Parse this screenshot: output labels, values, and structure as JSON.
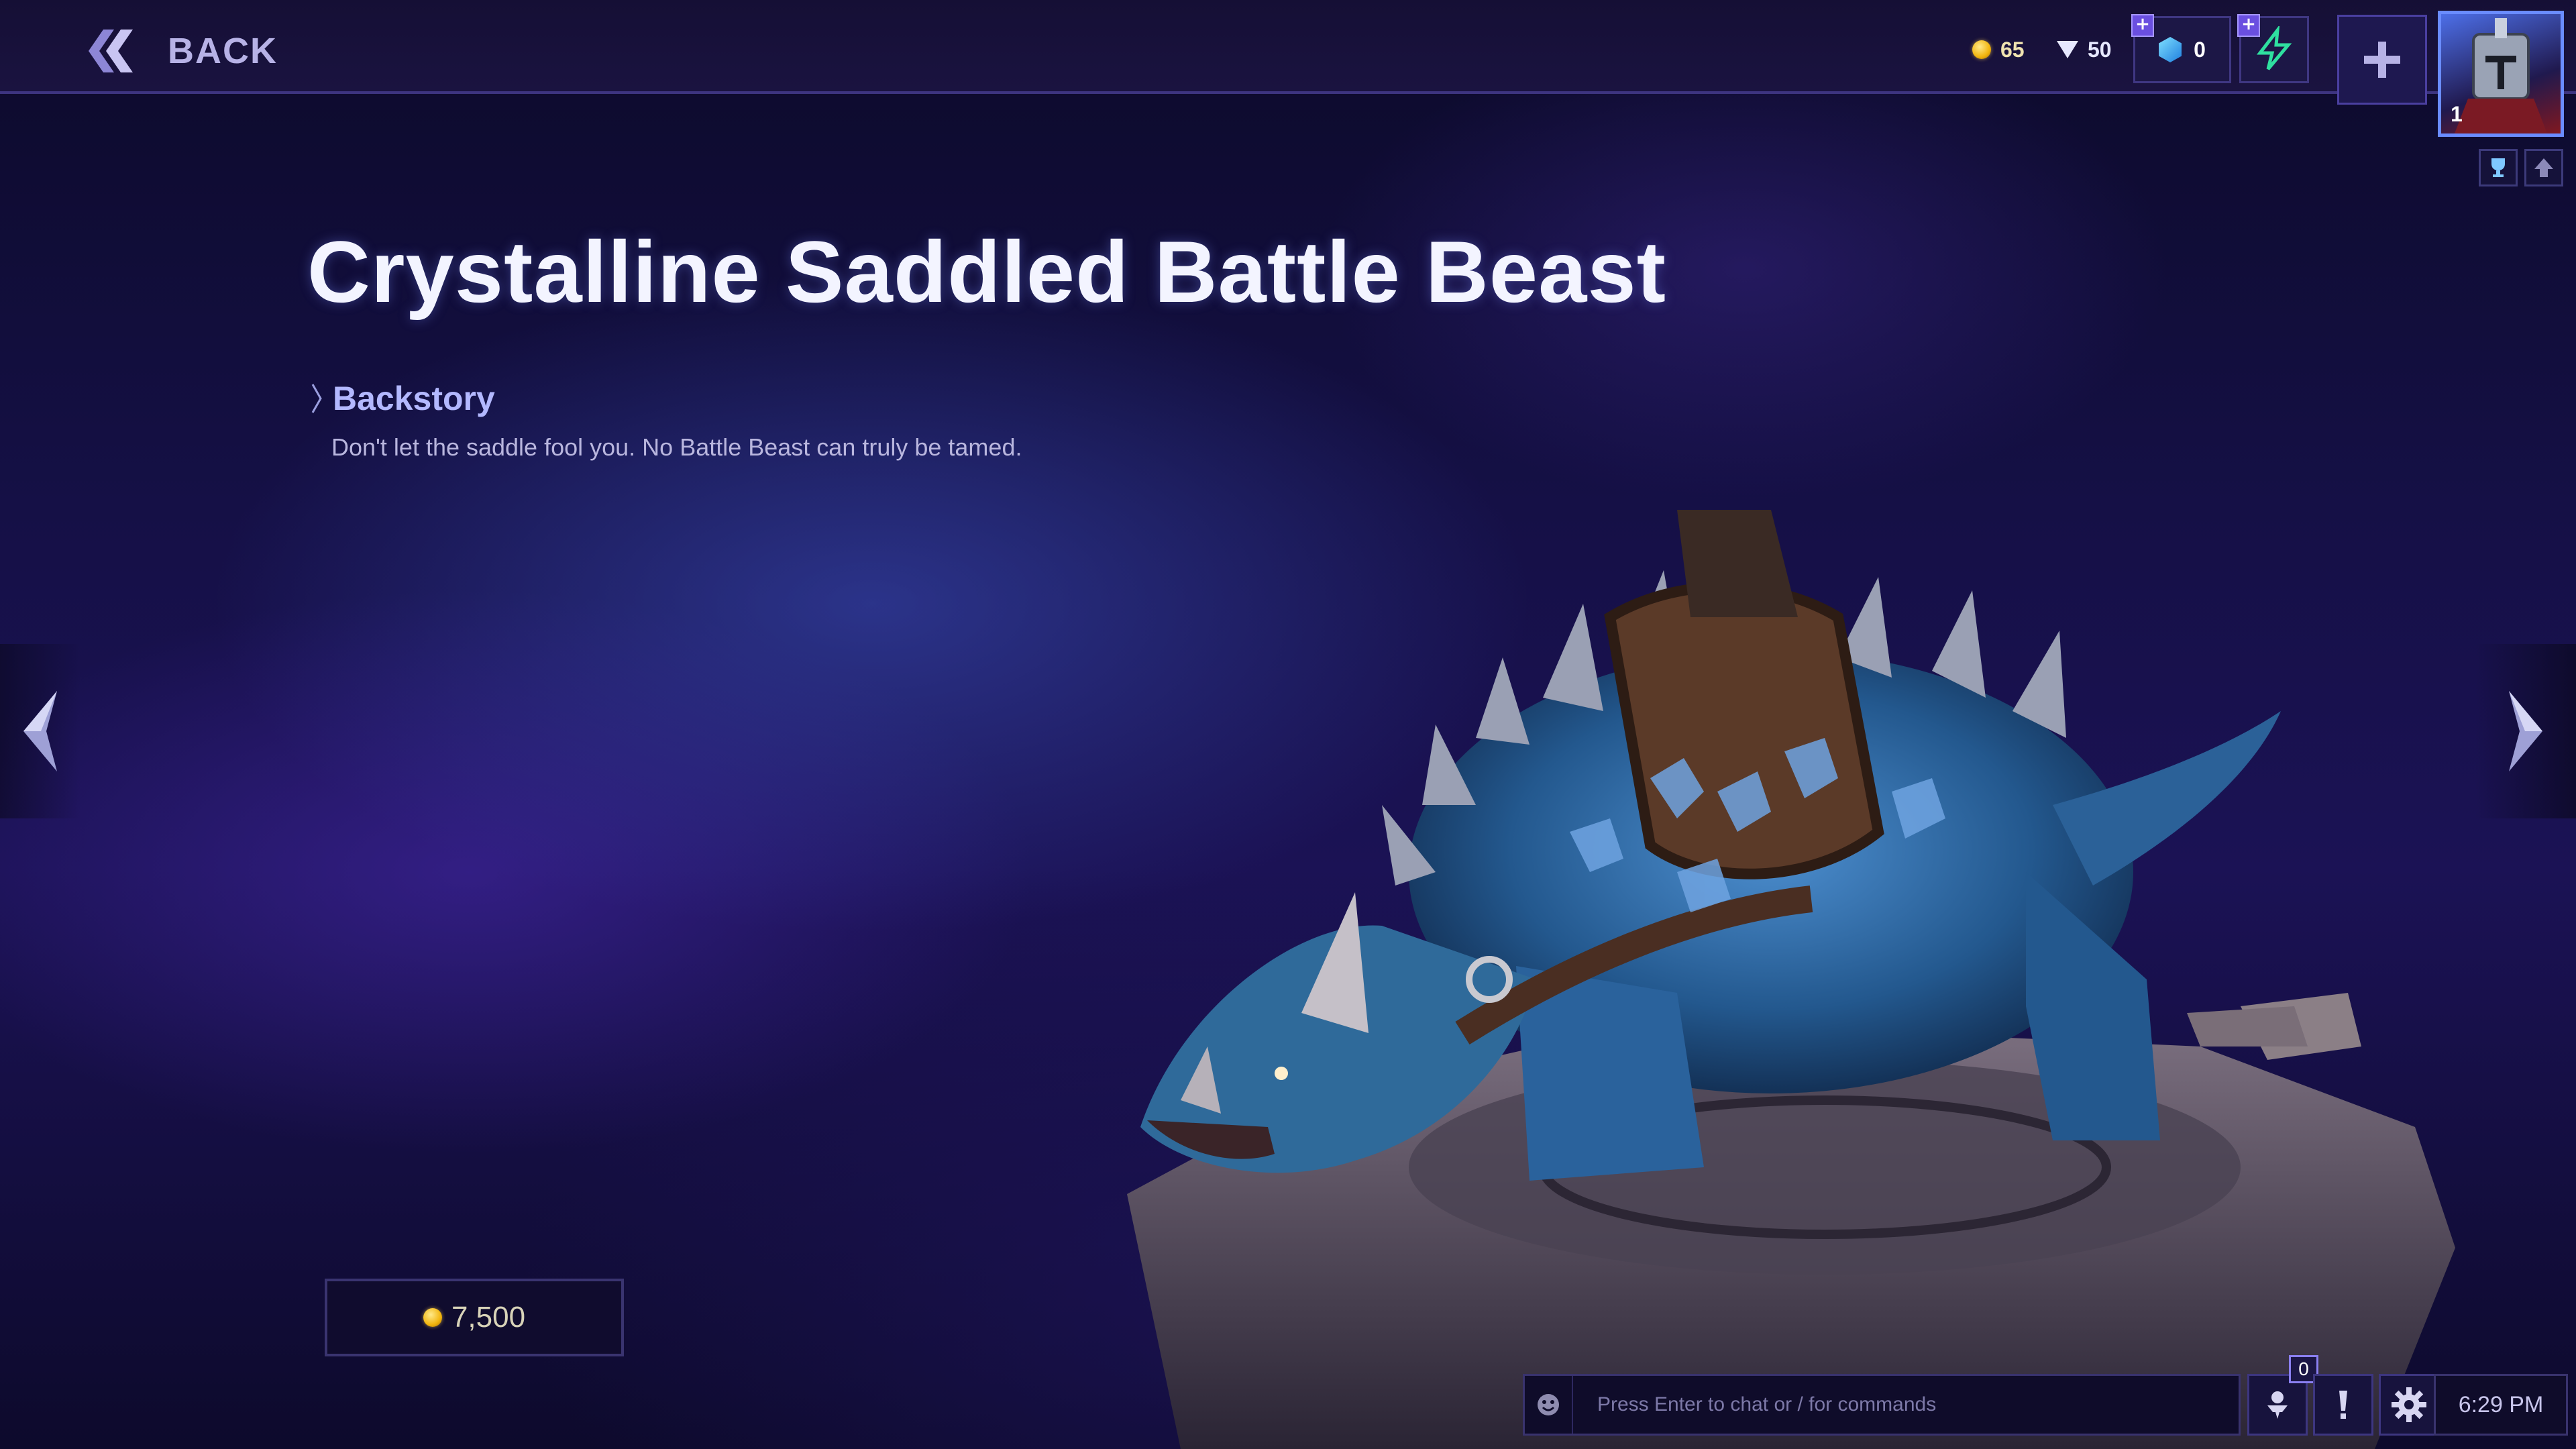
{
  "header": {
    "back_label": "BACK",
    "gold": "65",
    "shards": "50",
    "gems": "0",
    "avatar_level": "1"
  },
  "skin": {
    "title": "Crystalline Saddled Battle Beast",
    "backstory_label": "Backstory",
    "backstory_text": "Don't let the saddle fool you. No Battle Beast can truly be tamed.",
    "price": "7,500"
  },
  "chat": {
    "placeholder": "Press Enter to chat or / for commands",
    "notification_count": "0"
  },
  "clock": "6:29 PM",
  "icons": {
    "back": "double-chevron-left-icon",
    "gold": "gold-coin-icon",
    "shard": "shard-icon",
    "gem": "gem-icon",
    "boost": "lightning-icon",
    "add": "plus-icon",
    "emoji": "smiley-icon",
    "social": "friends-icon",
    "alert": "exclamation-icon",
    "settings": "gear-icon"
  },
  "colors": {
    "accent": "#6a4fe0",
    "gold": "#f2b50e",
    "boost": "#2fe0a0"
  }
}
